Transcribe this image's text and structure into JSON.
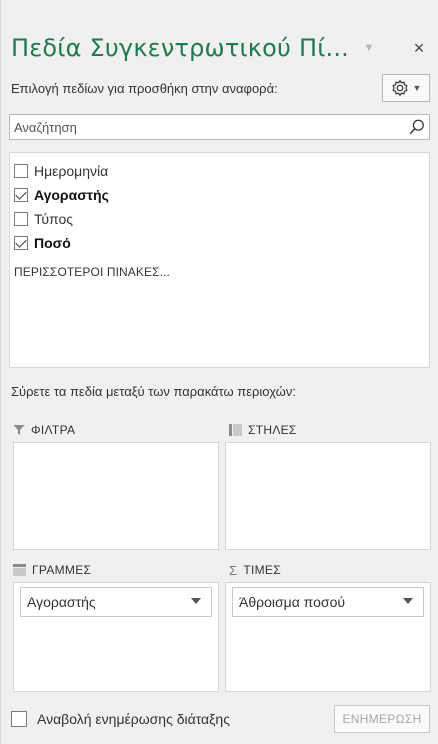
{
  "header": {
    "title": "Πεδία Συγκεντρωτικού Πί...",
    "close_glyph": "×",
    "dropdown_glyph": "▼"
  },
  "choose_fields": {
    "label": "Επιλογή πεδίων για προσθήκη στην αναφορά:",
    "tools_icon": "gear-icon"
  },
  "search": {
    "placeholder": "Αναζήτηση",
    "value": ""
  },
  "fields": [
    {
      "label": "Ημερομηνία",
      "checked": false
    },
    {
      "label": "Αγοραστής",
      "checked": true
    },
    {
      "label": "Τύπος",
      "checked": false
    },
    {
      "label": "Ποσό",
      "checked": true
    }
  ],
  "more_tables": "ΠΕΡΙΣΣΟΤΕΡΟΙ ΠΙΝΑΚΕΣ...",
  "drag_instructions": "Σύρετε τα πεδία μεταξύ των παρακάτω περιοχών:",
  "areas": {
    "filters": {
      "label": "ΦΙΛΤΡΑ",
      "icon": "filter-icon",
      "items": []
    },
    "columns": {
      "label": "ΣΤΗΛΕΣ",
      "icon": "columns-icon",
      "items": []
    },
    "rows": {
      "label": "ΓΡΑΜΜΕΣ",
      "icon": "rows-icon",
      "items": [
        "Αγοραστής"
      ]
    },
    "values": {
      "label": "ΤΙΜΕΣ",
      "icon": "sigma-icon",
      "icon_glyph": "Σ",
      "items": [
        "Άθροισμα ποσού"
      ]
    }
  },
  "footer": {
    "defer_label": "Αναβολή ενημέρωσης διάταξης",
    "defer_checked": false,
    "update_label": "ΕΝΗΜΕΡΩΣΗ"
  },
  "colors": {
    "title": "#1f7a4d",
    "background": "#f0f0f0"
  }
}
